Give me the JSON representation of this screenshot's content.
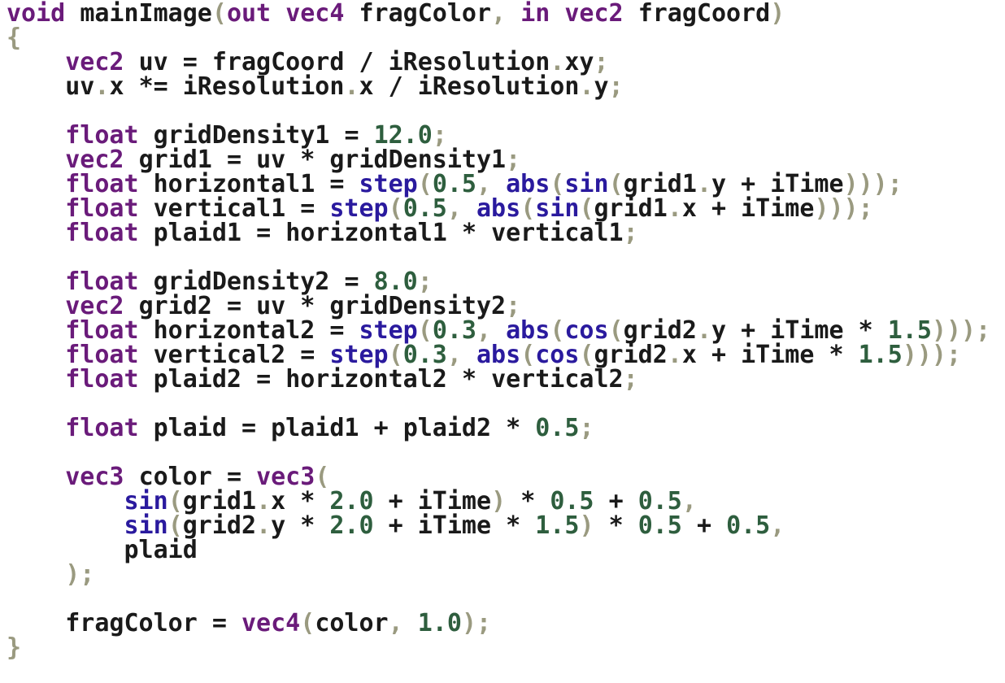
{
  "editor": {
    "language": "GLSL",
    "colors": {
      "keyword": "#6a1b7a",
      "builtin_function": "#2a1a9e",
      "number": "#2e5e3e",
      "punctuation": "#9a9a80",
      "identifier": "#1a1a1a",
      "background": "#ffffff"
    },
    "lines": [
      [
        [
          "kw",
          "void"
        ],
        [
          "ws",
          " "
        ],
        [
          "id",
          "mainImage"
        ],
        [
          "pun",
          "("
        ],
        [
          "kw",
          "out"
        ],
        [
          "ws",
          " "
        ],
        [
          "kw",
          "vec4"
        ],
        [
          "ws",
          " "
        ],
        [
          "id",
          "fragColor"
        ],
        [
          "pun",
          ","
        ],
        [
          "ws",
          " "
        ],
        [
          "kw",
          "in"
        ],
        [
          "ws",
          " "
        ],
        [
          "kw",
          "vec2"
        ],
        [
          "ws",
          " "
        ],
        [
          "id",
          "fragCoord"
        ],
        [
          "pun",
          ")"
        ]
      ],
      [
        [
          "pun",
          "{"
        ]
      ],
      [
        [
          "ws",
          "    "
        ],
        [
          "kw",
          "vec2"
        ],
        [
          "ws",
          " "
        ],
        [
          "id",
          "uv"
        ],
        [
          "ws",
          " "
        ],
        [
          "op",
          "="
        ],
        [
          "ws",
          " "
        ],
        [
          "id",
          "fragCoord"
        ],
        [
          "ws",
          " "
        ],
        [
          "op",
          "/"
        ],
        [
          "ws",
          " "
        ],
        [
          "id",
          "iResolution"
        ],
        [
          "pun",
          "."
        ],
        [
          "id",
          "xy"
        ],
        [
          "pun",
          ";"
        ]
      ],
      [
        [
          "ws",
          "    "
        ],
        [
          "id",
          "uv"
        ],
        [
          "pun",
          "."
        ],
        [
          "id",
          "x"
        ],
        [
          "ws",
          " "
        ],
        [
          "op",
          "*="
        ],
        [
          "ws",
          " "
        ],
        [
          "id",
          "iResolution"
        ],
        [
          "pun",
          "."
        ],
        [
          "id",
          "x"
        ],
        [
          "ws",
          " "
        ],
        [
          "op",
          "/"
        ],
        [
          "ws",
          " "
        ],
        [
          "id",
          "iResolution"
        ],
        [
          "pun",
          "."
        ],
        [
          "id",
          "y"
        ],
        [
          "pun",
          ";"
        ]
      ],
      [],
      [
        [
          "ws",
          "    "
        ],
        [
          "kw",
          "float"
        ],
        [
          "ws",
          " "
        ],
        [
          "id",
          "gridDensity1"
        ],
        [
          "ws",
          " "
        ],
        [
          "op",
          "="
        ],
        [
          "ws",
          " "
        ],
        [
          "num",
          "12.0"
        ],
        [
          "pun",
          ";"
        ]
      ],
      [
        [
          "ws",
          "    "
        ],
        [
          "kw",
          "vec2"
        ],
        [
          "ws",
          " "
        ],
        [
          "id",
          "grid1"
        ],
        [
          "ws",
          " "
        ],
        [
          "op",
          "="
        ],
        [
          "ws",
          " "
        ],
        [
          "id",
          "uv"
        ],
        [
          "ws",
          " "
        ],
        [
          "op",
          "*"
        ],
        [
          "ws",
          " "
        ],
        [
          "id",
          "gridDensity1"
        ],
        [
          "pun",
          ";"
        ]
      ],
      [
        [
          "ws",
          "    "
        ],
        [
          "kw",
          "float"
        ],
        [
          "ws",
          " "
        ],
        [
          "id",
          "horizontal1"
        ],
        [
          "ws",
          " "
        ],
        [
          "op",
          "="
        ],
        [
          "ws",
          " "
        ],
        [
          "fn",
          "step"
        ],
        [
          "pun",
          "("
        ],
        [
          "num",
          "0.5"
        ],
        [
          "pun",
          ","
        ],
        [
          "ws",
          " "
        ],
        [
          "fn",
          "abs"
        ],
        [
          "pun",
          "("
        ],
        [
          "fn",
          "sin"
        ],
        [
          "pun",
          "("
        ],
        [
          "id",
          "grid1"
        ],
        [
          "pun",
          "."
        ],
        [
          "id",
          "y"
        ],
        [
          "ws",
          " "
        ],
        [
          "op",
          "+"
        ],
        [
          "ws",
          " "
        ],
        [
          "id",
          "iTime"
        ],
        [
          "pun",
          ")));"
        ]
      ],
      [
        [
          "ws",
          "    "
        ],
        [
          "kw",
          "float"
        ],
        [
          "ws",
          " "
        ],
        [
          "id",
          "vertical1"
        ],
        [
          "ws",
          " "
        ],
        [
          "op",
          "="
        ],
        [
          "ws",
          " "
        ],
        [
          "fn",
          "step"
        ],
        [
          "pun",
          "("
        ],
        [
          "num",
          "0.5"
        ],
        [
          "pun",
          ","
        ],
        [
          "ws",
          " "
        ],
        [
          "fn",
          "abs"
        ],
        [
          "pun",
          "("
        ],
        [
          "fn",
          "sin"
        ],
        [
          "pun",
          "("
        ],
        [
          "id",
          "grid1"
        ],
        [
          "pun",
          "."
        ],
        [
          "id",
          "x"
        ],
        [
          "ws",
          " "
        ],
        [
          "op",
          "+"
        ],
        [
          "ws",
          " "
        ],
        [
          "id",
          "iTime"
        ],
        [
          "pun",
          ")));"
        ]
      ],
      [
        [
          "ws",
          "    "
        ],
        [
          "kw",
          "float"
        ],
        [
          "ws",
          " "
        ],
        [
          "id",
          "plaid1"
        ],
        [
          "ws",
          " "
        ],
        [
          "op",
          "="
        ],
        [
          "ws",
          " "
        ],
        [
          "id",
          "horizontal1"
        ],
        [
          "ws",
          " "
        ],
        [
          "op",
          "*"
        ],
        [
          "ws",
          " "
        ],
        [
          "id",
          "vertical1"
        ],
        [
          "pun",
          ";"
        ]
      ],
      [],
      [
        [
          "ws",
          "    "
        ],
        [
          "kw",
          "float"
        ],
        [
          "ws",
          " "
        ],
        [
          "id",
          "gridDensity2"
        ],
        [
          "ws",
          " "
        ],
        [
          "op",
          "="
        ],
        [
          "ws",
          " "
        ],
        [
          "num",
          "8.0"
        ],
        [
          "pun",
          ";"
        ]
      ],
      [
        [
          "ws",
          "    "
        ],
        [
          "kw",
          "vec2"
        ],
        [
          "ws",
          " "
        ],
        [
          "id",
          "grid2"
        ],
        [
          "ws",
          " "
        ],
        [
          "op",
          "="
        ],
        [
          "ws",
          " "
        ],
        [
          "id",
          "uv"
        ],
        [
          "ws",
          " "
        ],
        [
          "op",
          "*"
        ],
        [
          "ws",
          " "
        ],
        [
          "id",
          "gridDensity2"
        ],
        [
          "pun",
          ";"
        ]
      ],
      [
        [
          "ws",
          "    "
        ],
        [
          "kw",
          "float"
        ],
        [
          "ws",
          " "
        ],
        [
          "id",
          "horizontal2"
        ],
        [
          "ws",
          " "
        ],
        [
          "op",
          "="
        ],
        [
          "ws",
          " "
        ],
        [
          "fn",
          "step"
        ],
        [
          "pun",
          "("
        ],
        [
          "num",
          "0.3"
        ],
        [
          "pun",
          ","
        ],
        [
          "ws",
          " "
        ],
        [
          "fn",
          "abs"
        ],
        [
          "pun",
          "("
        ],
        [
          "fn",
          "cos"
        ],
        [
          "pun",
          "("
        ],
        [
          "id",
          "grid2"
        ],
        [
          "pun",
          "."
        ],
        [
          "id",
          "y"
        ],
        [
          "ws",
          " "
        ],
        [
          "op",
          "+"
        ],
        [
          "ws",
          " "
        ],
        [
          "id",
          "iTime"
        ],
        [
          "ws",
          " "
        ],
        [
          "op",
          "*"
        ],
        [
          "ws",
          " "
        ],
        [
          "num",
          "1.5"
        ],
        [
          "pun",
          ")));"
        ]
      ],
      [
        [
          "ws",
          "    "
        ],
        [
          "kw",
          "float"
        ],
        [
          "ws",
          " "
        ],
        [
          "id",
          "vertical2"
        ],
        [
          "ws",
          " "
        ],
        [
          "op",
          "="
        ],
        [
          "ws",
          " "
        ],
        [
          "fn",
          "step"
        ],
        [
          "pun",
          "("
        ],
        [
          "num",
          "0.3"
        ],
        [
          "pun",
          ","
        ],
        [
          "ws",
          " "
        ],
        [
          "fn",
          "abs"
        ],
        [
          "pun",
          "("
        ],
        [
          "fn",
          "cos"
        ],
        [
          "pun",
          "("
        ],
        [
          "id",
          "grid2"
        ],
        [
          "pun",
          "."
        ],
        [
          "id",
          "x"
        ],
        [
          "ws",
          " "
        ],
        [
          "op",
          "+"
        ],
        [
          "ws",
          " "
        ],
        [
          "id",
          "iTime"
        ],
        [
          "ws",
          " "
        ],
        [
          "op",
          "*"
        ],
        [
          "ws",
          " "
        ],
        [
          "num",
          "1.5"
        ],
        [
          "pun",
          ")));"
        ]
      ],
      [
        [
          "ws",
          "    "
        ],
        [
          "kw",
          "float"
        ],
        [
          "ws",
          " "
        ],
        [
          "id",
          "plaid2"
        ],
        [
          "ws",
          " "
        ],
        [
          "op",
          "="
        ],
        [
          "ws",
          " "
        ],
        [
          "id",
          "horizontal2"
        ],
        [
          "ws",
          " "
        ],
        [
          "op",
          "*"
        ],
        [
          "ws",
          " "
        ],
        [
          "id",
          "vertical2"
        ],
        [
          "pun",
          ";"
        ]
      ],
      [],
      [
        [
          "ws",
          "    "
        ],
        [
          "kw",
          "float"
        ],
        [
          "ws",
          " "
        ],
        [
          "id",
          "plaid"
        ],
        [
          "ws",
          " "
        ],
        [
          "op",
          "="
        ],
        [
          "ws",
          " "
        ],
        [
          "id",
          "plaid1"
        ],
        [
          "ws",
          " "
        ],
        [
          "op",
          "+"
        ],
        [
          "ws",
          " "
        ],
        [
          "id",
          "plaid2"
        ],
        [
          "ws",
          " "
        ],
        [
          "op",
          "*"
        ],
        [
          "ws",
          " "
        ],
        [
          "num",
          "0.5"
        ],
        [
          "pun",
          ";"
        ]
      ],
      [],
      [
        [
          "ws",
          "    "
        ],
        [
          "kw",
          "vec3"
        ],
        [
          "ws",
          " "
        ],
        [
          "id",
          "color"
        ],
        [
          "ws",
          " "
        ],
        [
          "op",
          "="
        ],
        [
          "ws",
          " "
        ],
        [
          "kw",
          "vec3"
        ],
        [
          "pun",
          "("
        ]
      ],
      [
        [
          "ws",
          "        "
        ],
        [
          "fn",
          "sin"
        ],
        [
          "pun",
          "("
        ],
        [
          "id",
          "grid1"
        ],
        [
          "pun",
          "."
        ],
        [
          "id",
          "x"
        ],
        [
          "ws",
          " "
        ],
        [
          "op",
          "*"
        ],
        [
          "ws",
          " "
        ],
        [
          "num",
          "2.0"
        ],
        [
          "ws",
          " "
        ],
        [
          "op",
          "+"
        ],
        [
          "ws",
          " "
        ],
        [
          "id",
          "iTime"
        ],
        [
          "pun",
          ")"
        ],
        [
          "ws",
          " "
        ],
        [
          "op",
          "*"
        ],
        [
          "ws",
          " "
        ],
        [
          "num",
          "0.5"
        ],
        [
          "ws",
          " "
        ],
        [
          "op",
          "+"
        ],
        [
          "ws",
          " "
        ],
        [
          "num",
          "0.5"
        ],
        [
          "pun",
          ","
        ]
      ],
      [
        [
          "ws",
          "        "
        ],
        [
          "fn",
          "sin"
        ],
        [
          "pun",
          "("
        ],
        [
          "id",
          "grid2"
        ],
        [
          "pun",
          "."
        ],
        [
          "id",
          "y"
        ],
        [
          "ws",
          " "
        ],
        [
          "op",
          "*"
        ],
        [
          "ws",
          " "
        ],
        [
          "num",
          "2.0"
        ],
        [
          "ws",
          " "
        ],
        [
          "op",
          "+"
        ],
        [
          "ws",
          " "
        ],
        [
          "id",
          "iTime"
        ],
        [
          "ws",
          " "
        ],
        [
          "op",
          "*"
        ],
        [
          "ws",
          " "
        ],
        [
          "num",
          "1.5"
        ],
        [
          "pun",
          ")"
        ],
        [
          "ws",
          " "
        ],
        [
          "op",
          "*"
        ],
        [
          "ws",
          " "
        ],
        [
          "num",
          "0.5"
        ],
        [
          "ws",
          " "
        ],
        [
          "op",
          "+"
        ],
        [
          "ws",
          " "
        ],
        [
          "num",
          "0.5"
        ],
        [
          "pun",
          ","
        ]
      ],
      [
        [
          "ws",
          "        "
        ],
        [
          "id",
          "plaid"
        ]
      ],
      [
        [
          "ws",
          "    "
        ],
        [
          "pun",
          ");"
        ]
      ],
      [],
      [
        [
          "ws",
          "    "
        ],
        [
          "id",
          "fragColor"
        ],
        [
          "ws",
          " "
        ],
        [
          "op",
          "="
        ],
        [
          "ws",
          " "
        ],
        [
          "kw",
          "vec4"
        ],
        [
          "pun",
          "("
        ],
        [
          "id",
          "color"
        ],
        [
          "pun",
          ","
        ],
        [
          "ws",
          " "
        ],
        [
          "num",
          "1.0"
        ],
        [
          "pun",
          ");"
        ]
      ],
      [
        [
          "pun",
          "}"
        ]
      ]
    ]
  }
}
